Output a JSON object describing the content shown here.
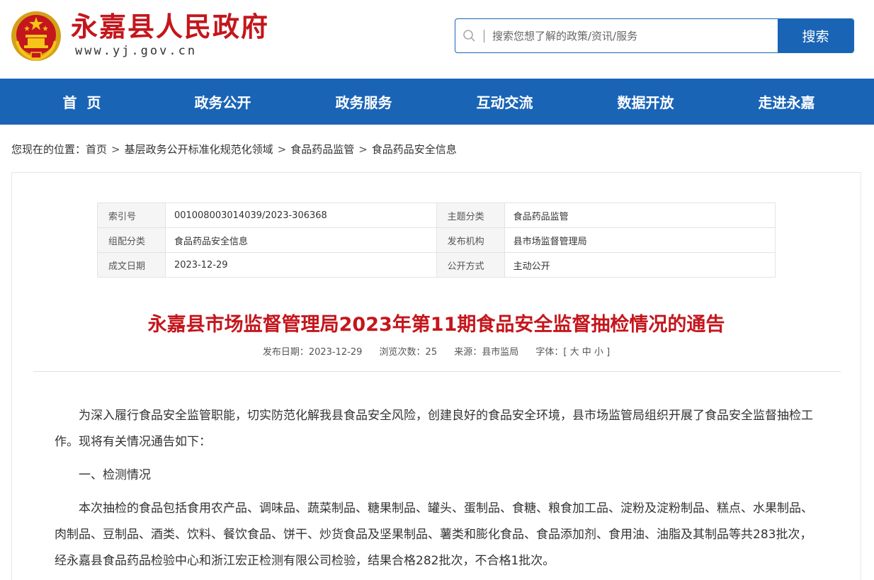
{
  "header": {
    "site_title": "永嘉县人民政府",
    "site_url": "www.yj.gov.cn",
    "search_placeholder": "搜索您想了解的政策/资讯/服务",
    "search_button": "搜索",
    "brand_blue": "#1a64b6",
    "brand_red": "#c4161c"
  },
  "nav": {
    "items": [
      "首页",
      "政务公开",
      "政务服务",
      "互动交流",
      "数据开放",
      "走进永嘉"
    ]
  },
  "breadcrumb": {
    "prefix": "您现在的位置：",
    "items": [
      "首页",
      "基层政务公开标准化规范化领域",
      "食品药品监管",
      "食品药品安全信息"
    ]
  },
  "meta": {
    "rows": [
      {
        "k1": "索引号",
        "v1": "001008003014039/2023-306368",
        "k2": "主题分类",
        "v2": "食品药品监管"
      },
      {
        "k1": "组配分类",
        "v1": "食品药品安全信息",
        "k2": "发布机构",
        "v2": "县市场监督管理局"
      },
      {
        "k1": "成文日期",
        "v1": "2023-12-29",
        "k2": "公开方式",
        "v2": "主动公开"
      }
    ]
  },
  "article": {
    "title": "永嘉县市场监督管理局2023年第11期食品安全监督抽检情况的通告",
    "publish_date": "发布日期：2023-12-29",
    "views": "浏览次数：25",
    "source": "来源：县市监局",
    "font_label": "字体：[",
    "font_large": "大",
    "font_medium": "中",
    "font_small": "小",
    "font_close": "]",
    "paragraphs": [
      "为深入履行食品安全监管职能，切实防范化解我县食品安全风险，创建良好的食品安全环境，县市场监管局组织开展了食品安全监督抽检工作。现将有关情况通告如下：",
      "一、检测情况",
      "本次抽检的食品包括食用农产品、调味品、蔬菜制品、糖果制品、罐头、蛋制品、食糖、粮食加工品、淀粉及淀粉制品、糕点、水果制品、肉制品、豆制品、酒类、饮料、餐饮食品、饼干、炒货食品及坚果制品、薯类和膨化食品、食品添加剂、食用油、油脂及其制品等共283批次，经永嘉县食品药品检验中心和浙江宏正检测有限公司检验，结果合格282批次，不合格1批次。"
    ]
  }
}
